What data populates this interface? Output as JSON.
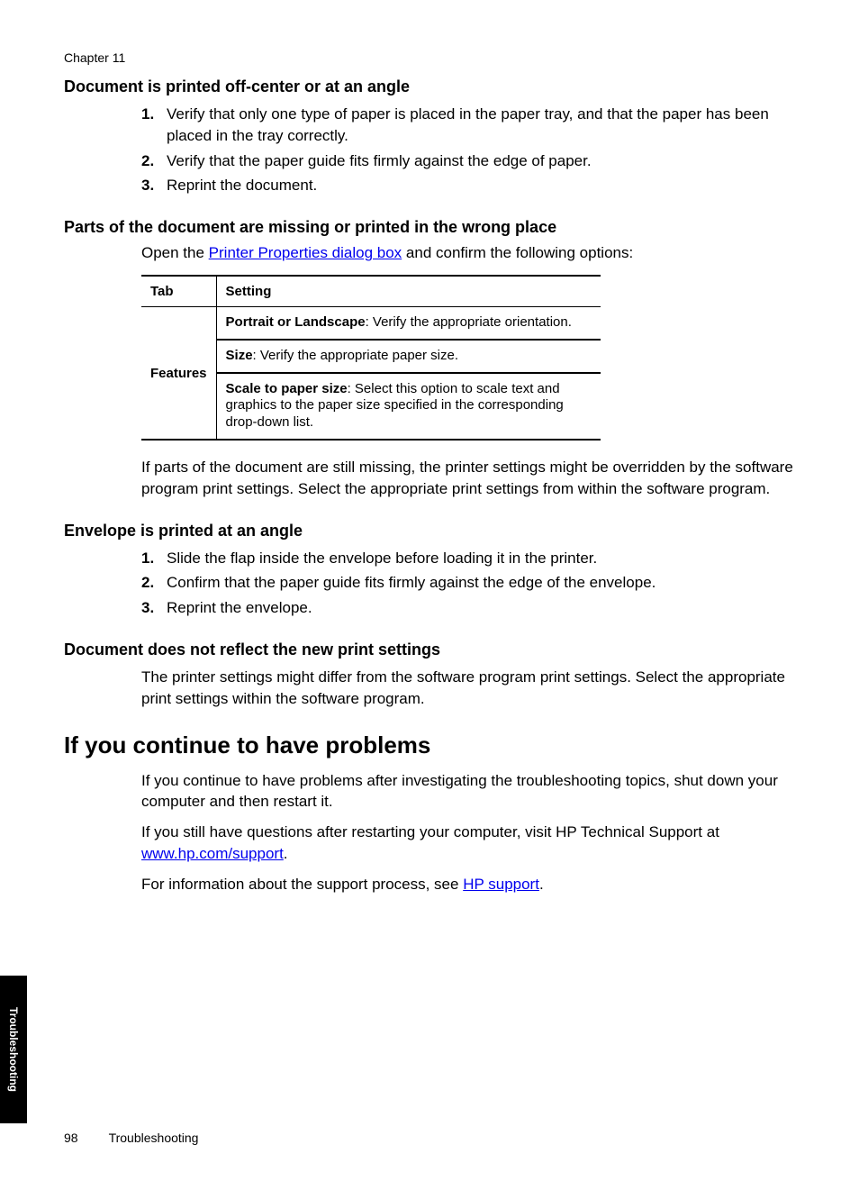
{
  "chapter_label": "Chapter 11",
  "section1": {
    "heading": "Document is printed off-center or at an angle",
    "items": [
      "Verify that only one type of paper is placed in the paper tray, and that the paper has been placed in the tray correctly.",
      "Verify that the paper guide fits firmly against the edge of paper.",
      "Reprint the document."
    ]
  },
  "section2": {
    "heading": "Parts of the document are missing or printed in the wrong place",
    "intro_pre": "Open the ",
    "intro_link": "Printer Properties dialog box",
    "intro_post": " and confirm the following options:",
    "table": {
      "header_tab": "Tab",
      "header_setting": "Setting",
      "tab_label": "Features",
      "rows": [
        {
          "bold": "Portrait or Landscape",
          "rest": ": Verify the appropriate orientation."
        },
        {
          "bold": "Size",
          "rest": ": Verify the appropriate paper size."
        },
        {
          "bold": "Scale to paper size",
          "rest": ": Select this option to scale text and graphics to the paper size specified in the corresponding drop-down list."
        }
      ]
    },
    "after_table": "If parts of the document are still missing, the printer settings might be overridden by the software program print settings. Select the appropriate print settings from within the software program."
  },
  "section3": {
    "heading": "Envelope is printed at an angle",
    "items": [
      "Slide the flap inside the envelope before loading it in the printer.",
      "Confirm that the paper guide fits firmly against the edge of the envelope.",
      "Reprint the envelope."
    ]
  },
  "section4": {
    "heading": "Document does not reflect the new print settings",
    "body": "The printer settings might differ from the software program print settings. Select the appropriate print settings within the software program."
  },
  "section5": {
    "heading": "If you continue to have problems",
    "p1": "If you continue to have problems after investigating the troubleshooting topics, shut down your computer and then restart it.",
    "p2_pre": "If you still have questions after restarting your computer, visit HP Technical Support at ",
    "p2_link": "www.hp.com/support",
    "p2_post": ".",
    "p3_pre": "For information about the support process, see ",
    "p3_link": "HP support",
    "p3_post": "."
  },
  "side_tab": "Troubleshooting",
  "footer": {
    "page": "98",
    "title": "Troubleshooting"
  }
}
